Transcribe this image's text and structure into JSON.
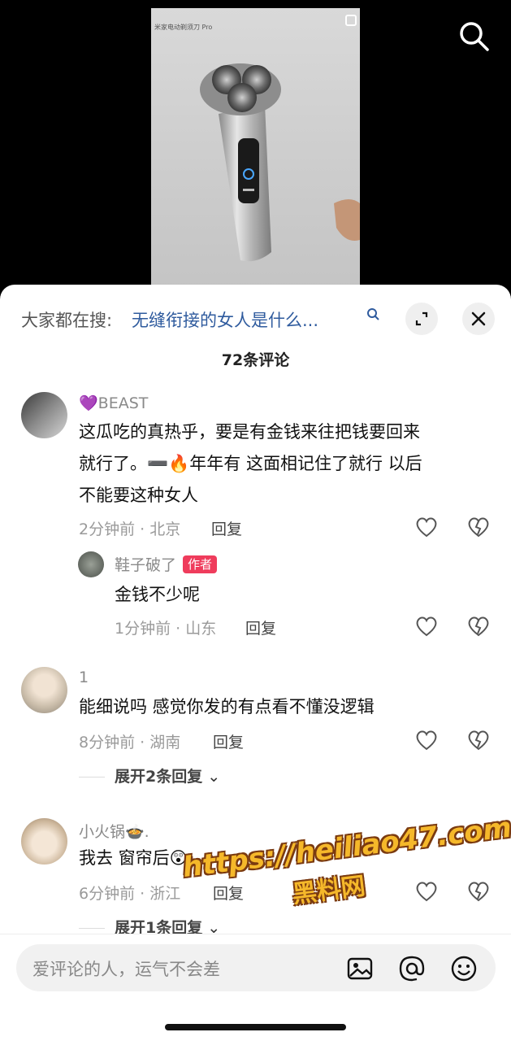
{
  "video": {
    "caption": "米家电动剃须刀 Pro"
  },
  "search_bar": {
    "prefix": "大家都在搜:",
    "query": "无缝衔接的女人是什么..."
  },
  "comment_count": "72条评论",
  "comments": [
    {
      "username": "💜BEAST",
      "lines": [
        "这瓜吃的真热乎，要是有金钱来往把钱要回来",
        "就行了。➖🔥年年有 这面相记住了就行 以后",
        "不能要这种女人"
      ],
      "time_location": "2分钟前 · 北京",
      "reply_label": "回复"
    },
    {
      "username": "鞋子破了",
      "badge": "作者",
      "lines": [
        "金钱不少呢"
      ],
      "time_location": "1分钟前 · 山东",
      "reply_label": "回复"
    },
    {
      "username": "1",
      "lines": [
        "能细说吗 感觉你发的有点看不懂没逻辑"
      ],
      "time_location": "8分钟前 · 湖南",
      "reply_label": "回复",
      "expand_label": "展开2条回复"
    },
    {
      "username": "小火锅🍲.",
      "lines": [
        "我去 窗帘后😲"
      ],
      "time_location": "6分钟前 · 浙江",
      "reply_label": "回复",
      "expand_label": "展开1条回复"
    }
  ],
  "watermark": {
    "url": "https://heiliao47.com",
    "name": "黑料网"
  },
  "input": {
    "placeholder": "爱评论的人，运气不会差"
  },
  "colors": {
    "link": "#2f5b9e",
    "author_badge": "#ef3c5c",
    "watermark": "#f5b82a"
  }
}
